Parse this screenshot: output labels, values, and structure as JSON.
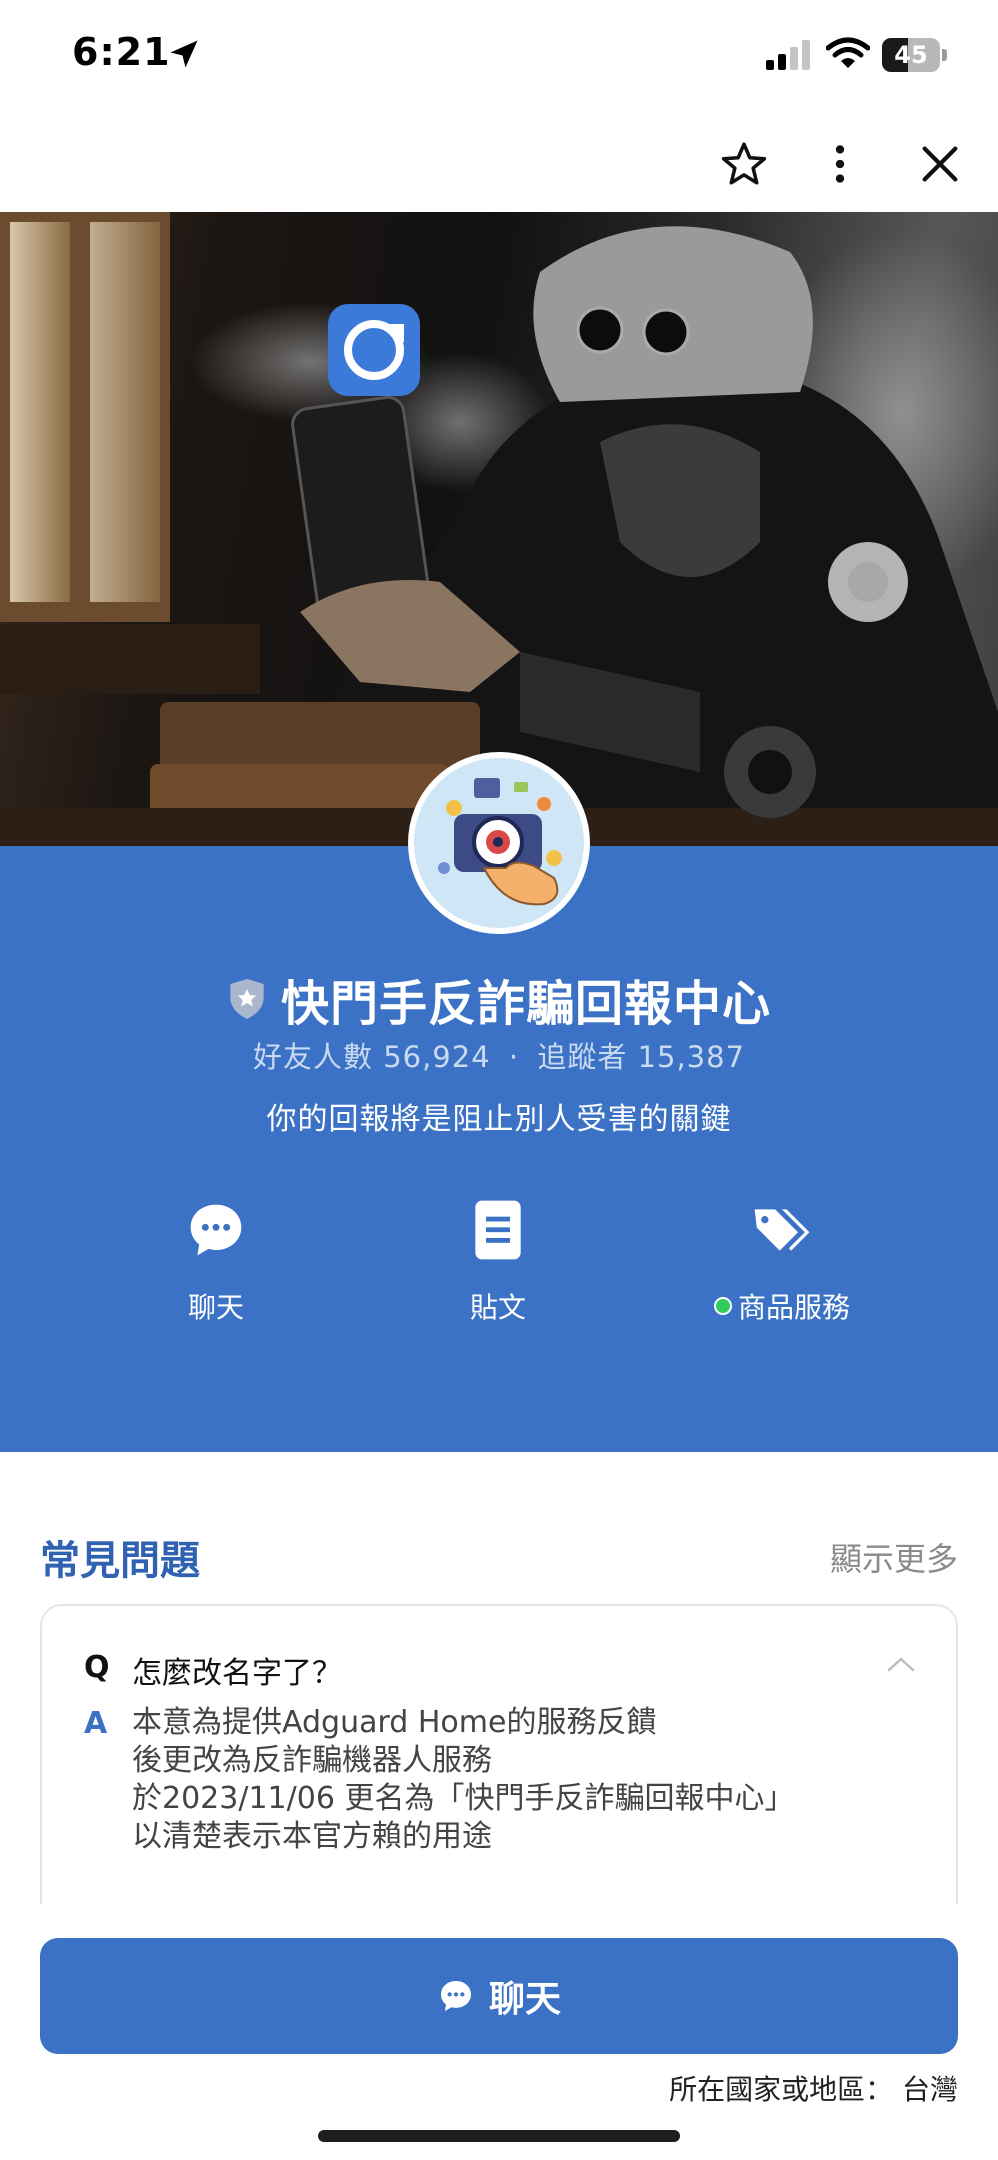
{
  "status_bar": {
    "time": "6:21",
    "battery": "45",
    "icons": [
      "location-arrow-icon",
      "signal-icon",
      "wifi-icon",
      "battery-icon"
    ]
  },
  "top_actions": {
    "icons": [
      "star-icon",
      "more-vertical-icon",
      "close-icon"
    ]
  },
  "profile": {
    "name": "快門手反詐騙回報中心",
    "friends_label": "好友人數",
    "friends_count": "56,924",
    "separator": "·",
    "followers_label": "追蹤者",
    "followers_count": "15,387",
    "status_message": "你的回報將是阻止別人受害的關鍵",
    "badge_icon": "shield-badge-icon"
  },
  "actions": [
    {
      "label": "聊天",
      "icon": "chat-bubble-icon"
    },
    {
      "label": "貼文",
      "icon": "document-icon"
    },
    {
      "label": "商品服務",
      "icon": "tag-icon"
    }
  ],
  "faq": {
    "title": "常見問題",
    "show_more": "顯示更多",
    "question_marker": "Q",
    "question": "怎麼改名字了？",
    "answer_marker": "A",
    "answer_lines": [
      "本意為提供Adguard Home的服務反饋",
      "後更改為反詐騙機器人服務",
      "於2023/11/06 更名為「快門手反詐騙回報中心」",
      "以清楚表示本官方賴的用途"
    ]
  },
  "chat_button": {
    "label": "聊天"
  },
  "region": {
    "label": "所在國家或地區：",
    "value": "台灣"
  },
  "colors": {
    "brand_blue": "#3b72c5",
    "faq_title": "#2f62b0",
    "online_green": "#2fcd5e"
  }
}
